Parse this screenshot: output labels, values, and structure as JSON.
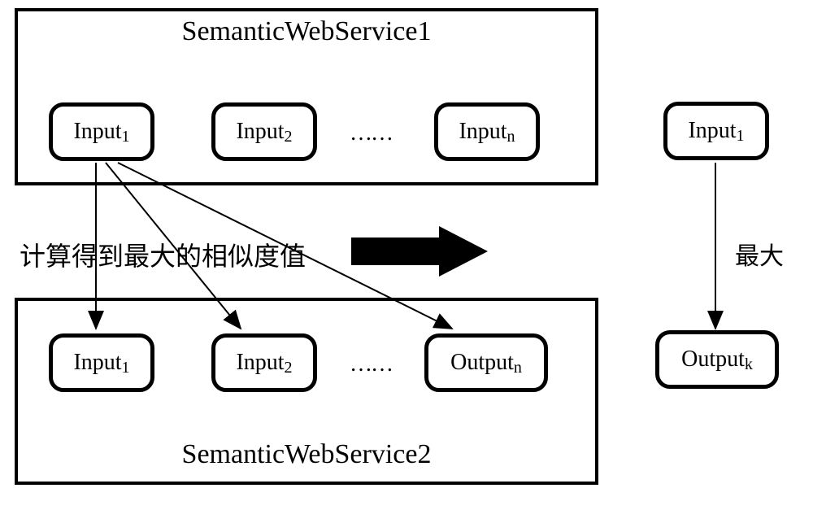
{
  "service1": {
    "title": "SemanticWebService1",
    "inputs": [
      "Input",
      "Input",
      "Input"
    ],
    "subs": [
      "1",
      "2",
      "n"
    ],
    "dots": "……"
  },
  "service2": {
    "title": "SemanticWebService2",
    "nodes": [
      "Input",
      "Input",
      "Output"
    ],
    "subs": [
      "1",
      "2",
      "n"
    ],
    "dots": "……"
  },
  "middle_text": "计算得到最大的相似度值",
  "right": {
    "input_label": "Input",
    "input_sub": "1",
    "output_label": "Output",
    "output_sub": "k",
    "max_label": "最大"
  }
}
